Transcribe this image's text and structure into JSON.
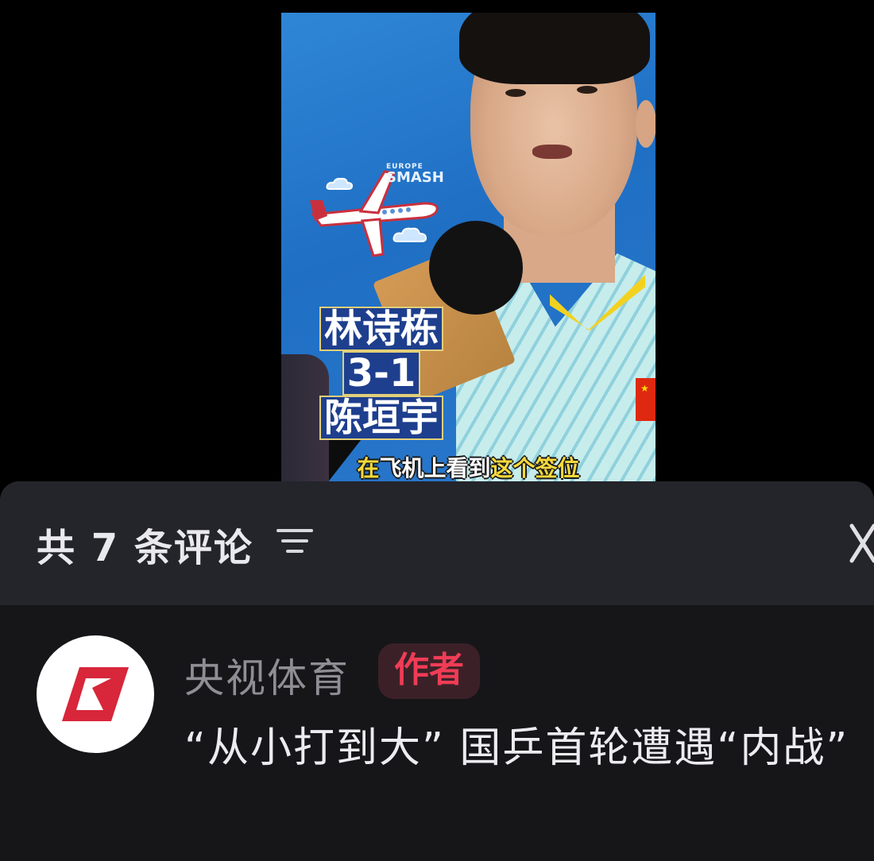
{
  "video": {
    "event_logo_line1": "EUROPE",
    "event_logo_line2": "SMASH",
    "overlay_title": [
      "林诗栋",
      "3-1",
      "陈垣宇"
    ],
    "subtitle_parts": [
      {
        "text": "在",
        "highlight": true
      },
      {
        "text": "飞机上看到",
        "highlight": false
      },
      {
        "text": "这个签位",
        "highlight": true
      }
    ],
    "flag_star": "★"
  },
  "comments": {
    "header_label": "共 7 条评论",
    "items": [
      {
        "author": "央视体育",
        "badge": "作者",
        "text": "“从小打到大” 国乒首轮遭遇“内战”"
      }
    ]
  },
  "colors": {
    "badge_text": "#f03c56",
    "badge_bg": "#3b2127",
    "avatar_logo": "#d8263a",
    "subtitle_highlight": "#f7d93b"
  },
  "icons": [
    "sort-icon",
    "close-icon",
    "cctv-sports-logo-icon",
    "plane-icon",
    "cloud-icon"
  ]
}
